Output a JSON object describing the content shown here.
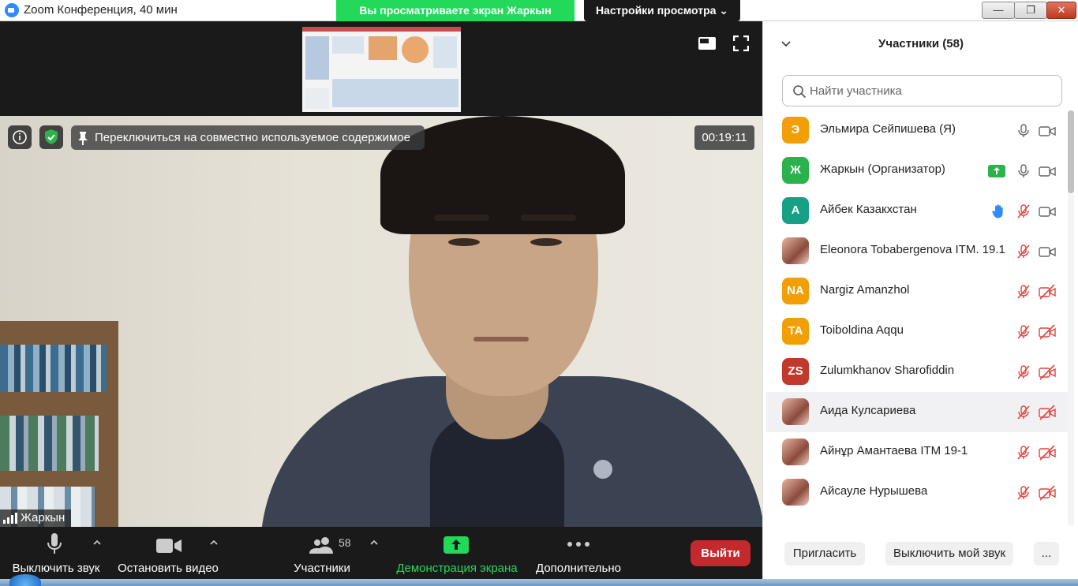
{
  "window": {
    "title": "Zoom Конференция, 40 мин",
    "viewing_banner": "Вы просматриваете экран Жаркын",
    "view_settings": "Настройки просмотра ⌄",
    "minimize": "—",
    "maximize": "❐",
    "close": "✕"
  },
  "video": {
    "switch_label": "Переключиться на совместно используемое содержимое",
    "timer": "00:19:11",
    "speaker_name": "Жаркын"
  },
  "toolbar": {
    "mute": "Выключить звук",
    "stop_video": "Остановить видео",
    "participants": "Участники",
    "participants_count": "58",
    "share_screen": "Демонстрация экрана",
    "more": "Дополнительно",
    "leave": "Выйти",
    "share_color": "#23d959",
    "leave_color": "#c4292d"
  },
  "panel": {
    "title": "Участники (58)",
    "search_placeholder": "Найти участника",
    "participants": [
      {
        "initials": "Э",
        "name": "Эльмира Сейпишева (Я)",
        "color": "#f29f05",
        "mic": "on",
        "video": "on"
      },
      {
        "initials": "Ж",
        "name": "Жаркын (Организатор)",
        "color": "#2bb24c",
        "mic": "on",
        "video": "on",
        "sharing": true
      },
      {
        "initials": "А",
        "name": "Айбек Казакхстан",
        "color": "#16a085",
        "mic": "muted",
        "video": "on",
        "hand": true
      },
      {
        "initials": "",
        "name": "Eleonora Tobabergenova ITM. 19.1",
        "color": "photo",
        "mic": "muted",
        "video": "on"
      },
      {
        "initials": "NA",
        "name": "Nargiz Amanzhol",
        "color": "#f29f05",
        "mic": "muted",
        "video": "off"
      },
      {
        "initials": "TA",
        "name": "Toiboldina Aqqu",
        "color": "#f29f05",
        "mic": "muted",
        "video": "off"
      },
      {
        "initials": "ZS",
        "name": "Zulumkhanov Sharofiddin",
        "color": "#c0392b",
        "mic": "muted",
        "video": "off"
      },
      {
        "initials": "",
        "name": "Аида Кулсариева",
        "color": "photo",
        "mic": "muted",
        "video": "off"
      },
      {
        "initials": "",
        "name": "Айнұр Амантаева ITM 19-1",
        "color": "photo",
        "mic": "muted",
        "video": "off"
      },
      {
        "initials": "",
        "name": "Айсауле Нурышева",
        "color": "photo",
        "mic": "muted",
        "video": "off"
      }
    ],
    "invite": "Пригласить",
    "mute_me": "Выключить мой звук",
    "more": "..."
  }
}
